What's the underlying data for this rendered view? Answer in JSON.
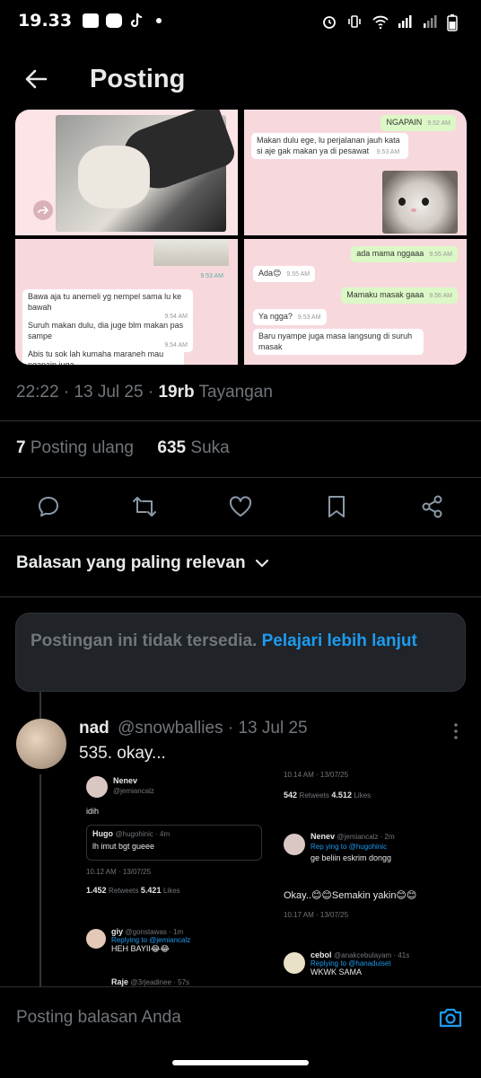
{
  "status_bar": {
    "time": "19.33"
  },
  "header": {
    "title": "Posting"
  },
  "media": {
    "chat1": {
      "ngapain": "NGAPAIN",
      "ngapain_time": "9.52 AM",
      "makan": "Makan dulu ege, lu perjalanan jauh kata si aje gak makan ya di pesawat",
      "makan_time": "9.53 AM"
    },
    "chat2": {
      "bawa": "Bawa aja tu anemeli yg nempel sama lu ke bawah",
      "bawa_time": "9.54 AM",
      "suruh": "Suruh makan dulu, dia juge blm makan pas sampe",
      "suruh_time": "9.54 AM",
      "abis": "Abis tu sok lah kumaha maraneh mau ngapain juga",
      "top_time": "9.53 AM"
    },
    "chat3": {
      "ada_mama": "ada mama nggaaa",
      "ada_mama_time": "9.55 AM",
      "ada": "Ada😊",
      "ada_time": "9.55 AM",
      "mamaku": "Mamaku masak gaaa",
      "mamaku_time": "9.56 AM",
      "yangga": "Ya ngga?",
      "yangga_time": "9.53 AM",
      "baru": "Baru nyampe juga masa langsung di suruh masak"
    }
  },
  "post_meta": {
    "time": "22:22",
    "date": "13 Jul 25",
    "views_count": "19rb",
    "views_label": "Tayangan"
  },
  "stats": {
    "reposts_count": "7",
    "reposts_label": "Posting ulang",
    "likes_count": "635",
    "likes_label": "Suka"
  },
  "relevance_label": "Balasan yang paling relevan",
  "unavailable": {
    "text": "Postingan ini tidak tersedia.",
    "link": "Pelajari lebih lanjut"
  },
  "reply": {
    "name": "nad",
    "handle": "@snowballies",
    "date": "13 Jul 25",
    "text": "535. okay...",
    "media_left": {
      "author": "Nenev",
      "handle": "@jemiancalz",
      "body": "idih",
      "quote_author": "Hugo",
      "quote_handle": "@hugohinic · 4m",
      "quote_body": "lh imut bgt gueee",
      "time": "10.12 AM · 13/07/25",
      "reposts": "1.452",
      "reposts_label": "Retweets",
      "likes": "5.421",
      "likes_label": "Likes",
      "sub_author": "giy",
      "sub_handle": "@gonstawas · 1m",
      "sub_reply": "Replying to @jemiancalz",
      "sub_body": "HEH BAYII😂😂",
      "sub2_author": "Raje",
      "sub2_handle": "@3rjeadinee · 57s"
    },
    "media_right": {
      "top_time": "10.14 AM · 13/07/25",
      "reposts": "542",
      "reposts_label": "Retweets",
      "likes": "4.512",
      "likes_label": "Likes",
      "author": "Nenev",
      "handle": "@jemiancalz · 2m",
      "reply_to": "Rep ying to @hugohinic",
      "body": "ge beliin eskrim dongg",
      "main": "Okay..😊😊Semakin yakin😊😊",
      "time": "10.17 AM · 13/07/25",
      "sub_author": "cebol",
      "sub_handle": "@anakcebulayam · 41s",
      "sub_reply": "Replying to @hanaduiset",
      "sub_body": "WKWK SAMA"
    }
  },
  "reply_bar": {
    "placeholder": "Posting balasan Anda"
  },
  "colors": {
    "accent": "#1d9bf0",
    "background": "#000000",
    "muted": "#71767b"
  }
}
